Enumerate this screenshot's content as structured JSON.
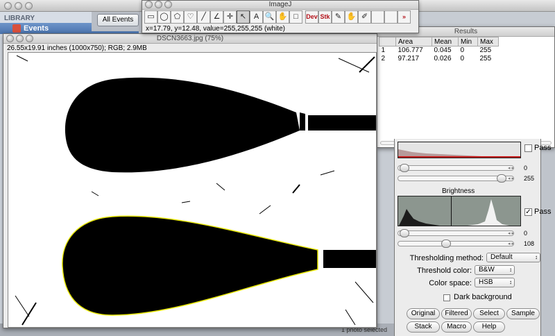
{
  "background_app": {
    "library_label": "LIBRARY",
    "events_label": "Events",
    "all_events_button": "All Events",
    "status_text": "1 photo selected"
  },
  "toolbar": {
    "title": "ImageJ",
    "tools": [
      {
        "name": "rectangle-tool-icon",
        "glyph": "▭"
      },
      {
        "name": "oval-tool-icon",
        "glyph": "◯"
      },
      {
        "name": "polygon-tool-icon",
        "glyph": "⬠"
      },
      {
        "name": "freehand-tool-icon",
        "glyph": "♡"
      },
      {
        "name": "line-tool-icon",
        "glyph": "╱"
      },
      {
        "name": "angle-tool-icon",
        "glyph": "∠"
      },
      {
        "name": "point-tool-icon",
        "glyph": "✛"
      },
      {
        "name": "wand-tool-icon",
        "glyph": "↖"
      },
      {
        "name": "text-tool-icon",
        "glyph": "A"
      },
      {
        "name": "magnifier-tool-icon",
        "glyph": "🔍"
      },
      {
        "name": "hand-tool-icon",
        "glyph": "✋"
      },
      {
        "name": "color-picker-tool-icon",
        "glyph": "□"
      },
      {
        "name": "dev-menu-icon",
        "glyph": "Dev"
      },
      {
        "name": "stk-menu-icon",
        "glyph": "Stk"
      },
      {
        "name": "brush-tool-icon",
        "glyph": "✎"
      },
      {
        "name": "flood-tool-icon",
        "glyph": "✋"
      },
      {
        "name": "pencil-tool-icon",
        "glyph": "✐"
      },
      {
        "name": "blank-tool",
        "glyph": ""
      },
      {
        "name": "blank-tool-2",
        "glyph": ""
      },
      {
        "name": "more-tools-icon",
        "glyph": "»"
      }
    ],
    "status": "x=17.79, y=12.48, value=255,255,255 (white)"
  },
  "image_window": {
    "title": "DSCN3663.jpg (75%)",
    "info": "26.55x19.91 inches (1000x750); RGB; 2.9MB"
  },
  "results": {
    "title": "Results",
    "columns": [
      "",
      "Area",
      "Mean",
      "Min",
      "Max"
    ],
    "rows": [
      [
        "1",
        "106.777",
        "0.045",
        "0",
        "255"
      ],
      [
        "2",
        "97.217",
        "0.026",
        "0",
        "255"
      ]
    ]
  },
  "threshold": {
    "top_pass_label": "Pass",
    "top_slider1_value": "0",
    "top_slider2_value": "255",
    "brightness_label": "Brightness",
    "brightness_pass_label": "Pass",
    "bright_slider1_value": "0",
    "bright_slider2_value": "108",
    "method_label": "Thresholding method:",
    "method_value": "Default",
    "color_label": "Threshold color:",
    "color_value": "B&W",
    "space_label": "Color space:",
    "space_value": "HSB",
    "dark_bg_label": "Dark background",
    "buttons": [
      "Original",
      "Filtered",
      "Select",
      "Sample",
      "Stack",
      "Macro",
      "Help"
    ]
  }
}
